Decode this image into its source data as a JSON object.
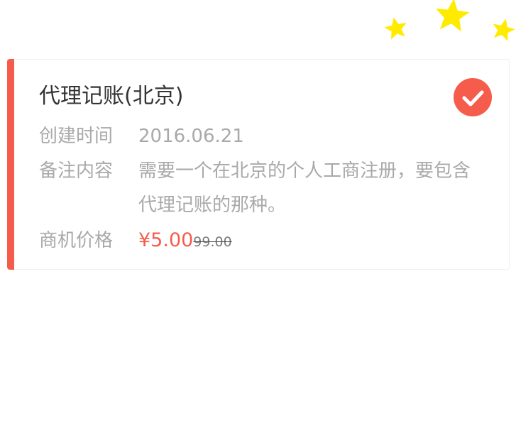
{
  "card": {
    "title": "代理记账(北京)",
    "created_label": "创建时间",
    "created_value": "2016.06.21",
    "note_label": "备注内容",
    "note_value": "需要一个在北京的个人工商注册，要包含代理记账的那种。",
    "price_label": "商机价格",
    "price_value": "¥5.00",
    "original_price": "99.00",
    "selected": true
  },
  "colors": {
    "accent": "#f55c4c",
    "star": "#ffeb00",
    "title": "#333333",
    "muted": "#a9a9a9"
  },
  "icons": {
    "check": "check-circle-icon",
    "stars": "star-icon"
  }
}
